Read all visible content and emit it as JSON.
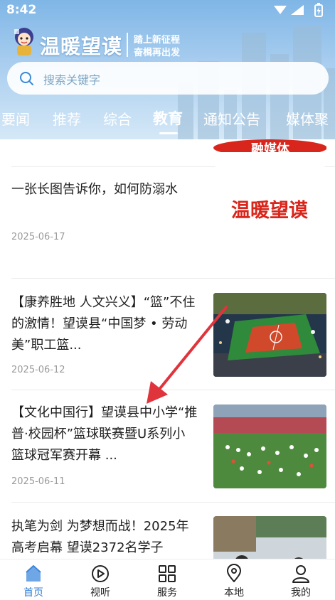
{
  "status": {
    "time": "8:42"
  },
  "brand": {
    "title": "温暖望谟",
    "slogan_line1": "踏上新征程",
    "slogan_line2": "奋楫再出发"
  },
  "search": {
    "placeholder": "搜索关键字"
  },
  "tabs": [
    {
      "label": "要闻"
    },
    {
      "label": "推荐"
    },
    {
      "label": "综合"
    },
    {
      "label": "教育",
      "active": true
    },
    {
      "label": "通知公告"
    },
    {
      "label": "媒体聚"
    }
  ],
  "feed": {
    "partial_thumb_text": "融媒体",
    "items": [
      {
        "title": "一张长图告诉你，如何防溺水",
        "date": "2025-06-17",
        "thumb_text_main": "温暖望谟",
        "thumb_text_sub": "融媒体"
      },
      {
        "title": "【康养胜地 人文兴义】“篮”不住的激情！望谟县“中国梦 • 劳动美”职工篮...",
        "date": "2025-06-12",
        "thumb": "basketball-arena-photo"
      },
      {
        "title": "【文化中国行】望谟县中小学“推普·校园杯”篮球联赛暨U系列小篮球冠军赛开幕 ...",
        "date": "2025-06-11",
        "thumb": "opening-ceremony-photo"
      },
      {
        "title": "执笔为剑 为梦想而战！2025年高考启幕 望谟2372名学子",
        "date": "",
        "thumb": "exam-gate-photo"
      }
    ]
  },
  "bottom_nav": [
    {
      "label": "首页",
      "icon": "home-icon",
      "active": true
    },
    {
      "label": "视听",
      "icon": "play-circle-icon"
    },
    {
      "label": "服务",
      "icon": "grid-icon"
    },
    {
      "label": "本地",
      "icon": "location-pin-icon"
    },
    {
      "label": "我的",
      "icon": "person-icon"
    }
  ],
  "colors": {
    "accent": "#2f7fd6",
    "brand_red": "#d9261c",
    "header_sky": "#7fb6e6"
  }
}
